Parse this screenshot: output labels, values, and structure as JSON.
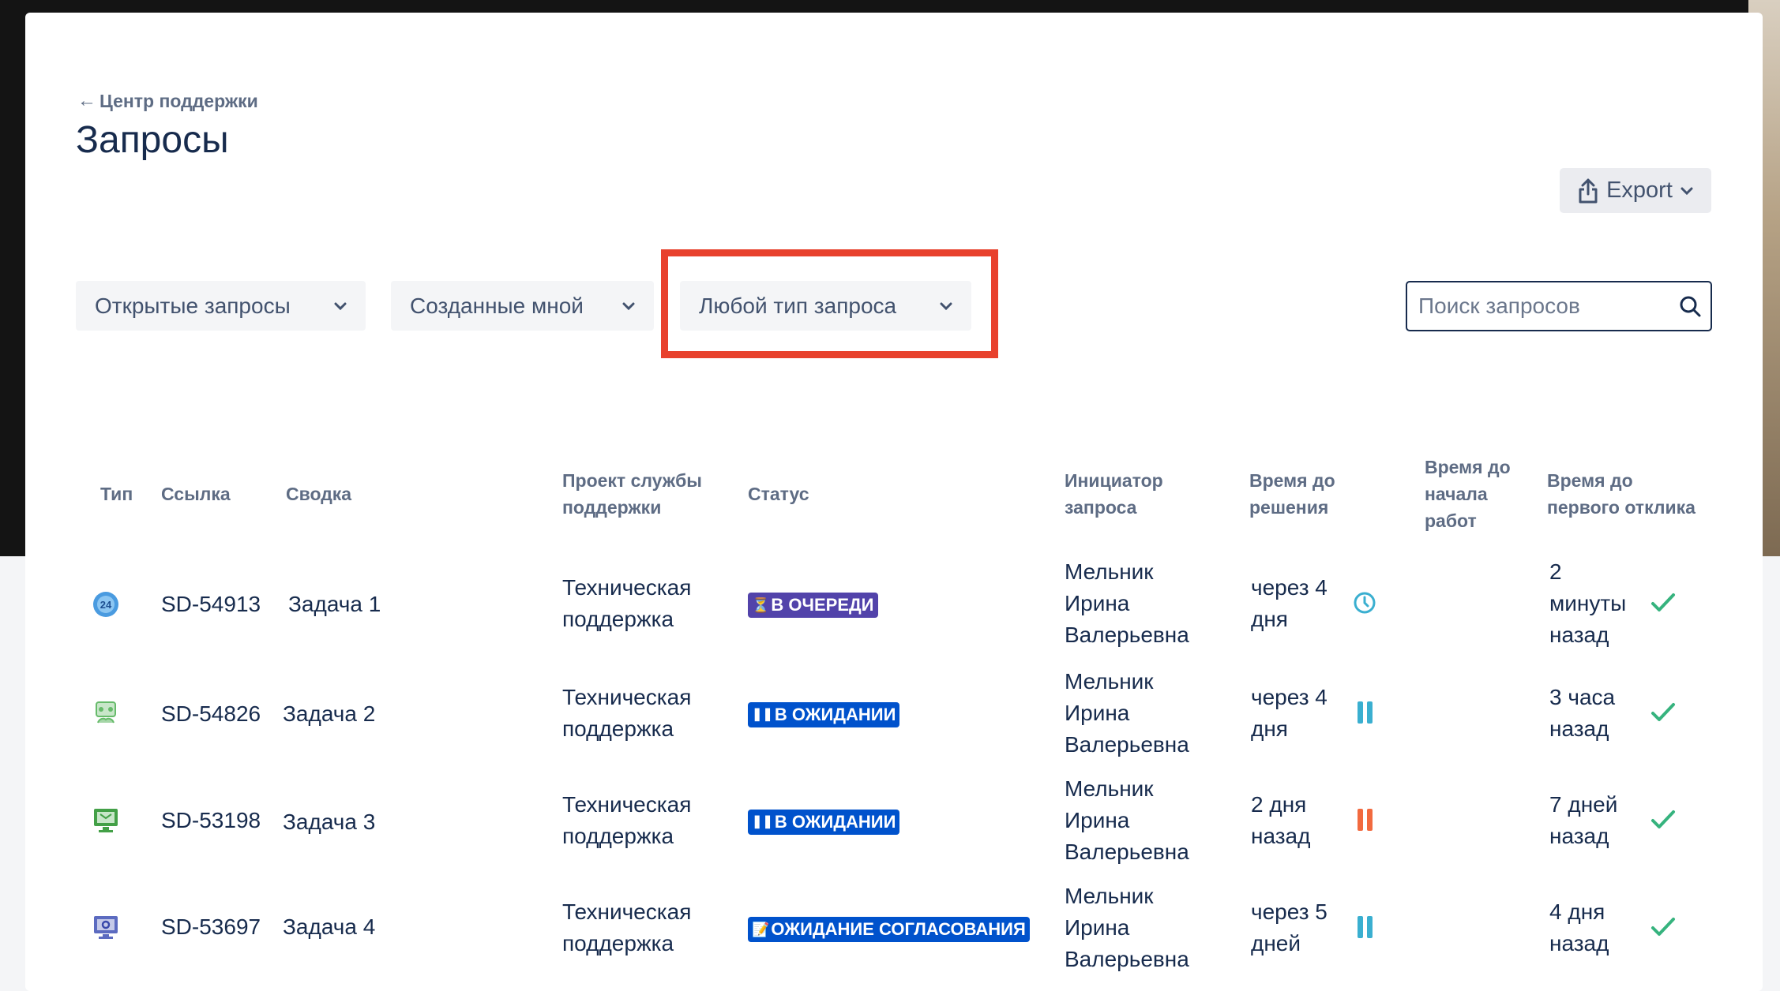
{
  "nav": {
    "back_label": "Центр поддержки"
  },
  "page": {
    "title": "Запросы"
  },
  "toolbar": {
    "export_label": "Export"
  },
  "filters": {
    "open_requests": "Открытые запросы",
    "created_by_me": "Созданные мной",
    "any_type": "Любой тип запроса"
  },
  "search": {
    "placeholder": "Поиск запросов"
  },
  "table": {
    "headers": {
      "type": "Тип",
      "ref": "Ссылка",
      "summary": "Сводка",
      "project_l1": "Проект службы",
      "project_l2": "поддержки",
      "status": "Статус",
      "reporter_l1": "Инициатор",
      "reporter_l2": "запроса",
      "resolution_l1": "Время до",
      "resolution_l2": "решения",
      "start_l1": "Время до",
      "start_l2": "начала",
      "start_l3": "работ",
      "first_l1": "Время до",
      "first_l2": "первого отклика"
    },
    "rows": [
      {
        "type_icon": "24-hour-support-icon",
        "ref": "SD-54913",
        "summary": "Задача 1",
        "project_l1": "Техническая",
        "project_l2": "поддержка",
        "status": "В ОЧЕРЕДИ",
        "reporter_l1": "Мельник",
        "reporter_l2": "Ирина",
        "reporter_l3": "Валерьевна",
        "resolution_l1": "через 4",
        "resolution_l2": "дня",
        "resolution_icon": "clock-icon",
        "first_l1": "2",
        "first_l2": "минуты",
        "first_l3": "назад"
      },
      {
        "type_icon": "group-icon",
        "ref": "SD-54826",
        "summary": "Задача 2",
        "project_l1": "Техническая",
        "project_l2": "поддержка",
        "status": "В ОЖИДАНИИ",
        "reporter_l1": "Мельник",
        "reporter_l2": "Ирина",
        "reporter_l3": "Валерьевна",
        "resolution_l1": "через 4",
        "resolution_l2": "дня",
        "resolution_icon": "pause-icon",
        "first_l1": "3 часа",
        "first_l2": "назад"
      },
      {
        "type_icon": "monitor-icon",
        "ref": "SD-53198",
        "summary": "Задача 3",
        "project_l1": "Техническая",
        "project_l2": "поддержка",
        "status": "В ОЖИДАНИИ",
        "reporter_l1": "Мельник",
        "reporter_l2": "Ирина",
        "reporter_l3": "Валерьевна",
        "resolution_l1": "2 дня",
        "resolution_l2": "назад",
        "resolution_icon": "pause-icon",
        "first_l1": "7 дней",
        "first_l2": "назад"
      },
      {
        "type_icon": "gear-monitor-icon",
        "ref": "SD-53697",
        "summary": "Задача 4",
        "project_l1": "Техническая",
        "project_l2": "поддержка",
        "status": "ОЖИДАНИЕ СОГЛАСОВАНИЯ",
        "reporter_l1": "Мельник",
        "reporter_l2": "Ирина",
        "reporter_l3": "Валерьевна",
        "resolution_l1": "через 5",
        "resolution_l2": "дней",
        "resolution_icon": "pause-icon",
        "first_l1": "4 дня",
        "first_l2": "назад"
      }
    ]
  },
  "colors": {
    "queue_lozenge": "#5243aa",
    "waiting_lozenge": "#0052cc",
    "sla_ok": "#36b37e",
    "sla_paused": "#3aafd0",
    "sla_breached": "#f26a3f",
    "highlight": "#e8412d"
  }
}
